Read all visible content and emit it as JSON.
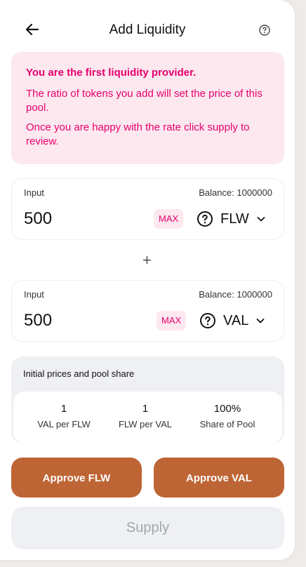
{
  "header": {
    "title": "Add Liquidity",
    "back_icon": "arrow-left-icon",
    "help_icon": "question-circle-icon"
  },
  "notice": {
    "heading": "You are the first liquidity provider.",
    "line1": "The ratio of tokens you add will set the price of this pool.",
    "line2": "Once you are happy with the rate click supply to review.",
    "color": "#e6006e",
    "background": "#fde8ef"
  },
  "input_a": {
    "label": "Input",
    "balance": "Balance: 1000000",
    "value": "500",
    "max_label": "MAX",
    "token": "FLW"
  },
  "plus_symbol": "+",
  "input_b": {
    "label": "Input",
    "balance": "Balance: 1000000",
    "value": "500",
    "max_label": "MAX",
    "token": "VAL"
  },
  "prices": {
    "title": "Initial prices and pool share",
    "items": [
      {
        "value": "1",
        "label": "VAL per FLW"
      },
      {
        "value": "1",
        "label": "FLW per VAL"
      },
      {
        "value": "100%",
        "label": "Share of Pool"
      }
    ]
  },
  "actions": {
    "approve_a": "Approve FLW",
    "approve_b": "Approve VAL",
    "supply": "Supply",
    "accent": "#be6535"
  }
}
